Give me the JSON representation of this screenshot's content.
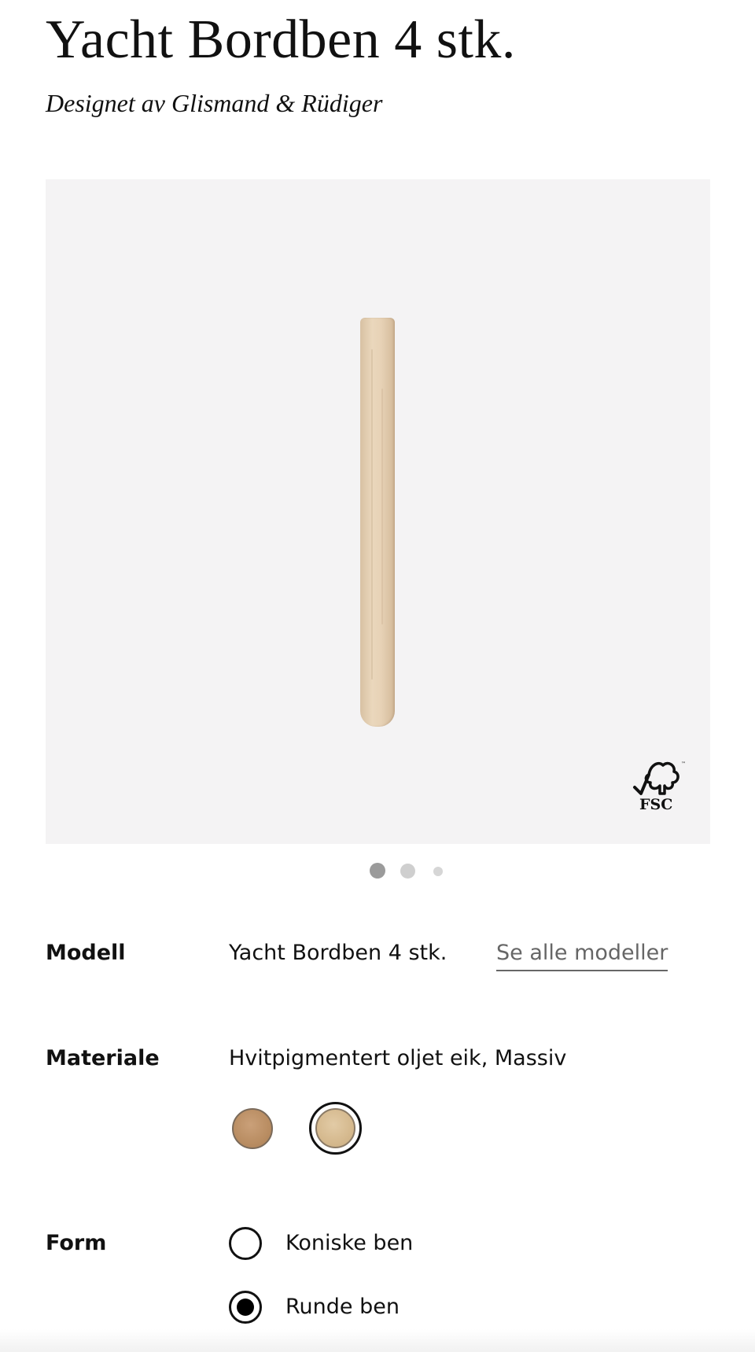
{
  "product": {
    "title": "Yacht Bordben 4 stk.",
    "designer": "Designet av Glismand & Rüdiger"
  },
  "gallery": {
    "background_color": "#f4f3f4",
    "image_subject": "table-leg",
    "certification_logo": "FSC",
    "slide_count": 3,
    "active_slide": 1
  },
  "options": {
    "model": {
      "label": "Modell",
      "value": "Yacht Bordben 4 stk.",
      "link": "Se alle modeller"
    },
    "material": {
      "label": "Materiale",
      "value": "Hvitpigmentert oljet eik, Massiv",
      "swatches": [
        {
          "name": "oak-swatch",
          "color": "#bf9369",
          "selected": false
        },
        {
          "name": "white-pigmented-oak-swatch",
          "color": "#d8bd94",
          "selected": true
        }
      ]
    },
    "form": {
      "label": "Form",
      "choices": [
        {
          "label": "Koniske ben",
          "selected": false
        },
        {
          "label": "Runde ben",
          "selected": true
        }
      ]
    }
  }
}
